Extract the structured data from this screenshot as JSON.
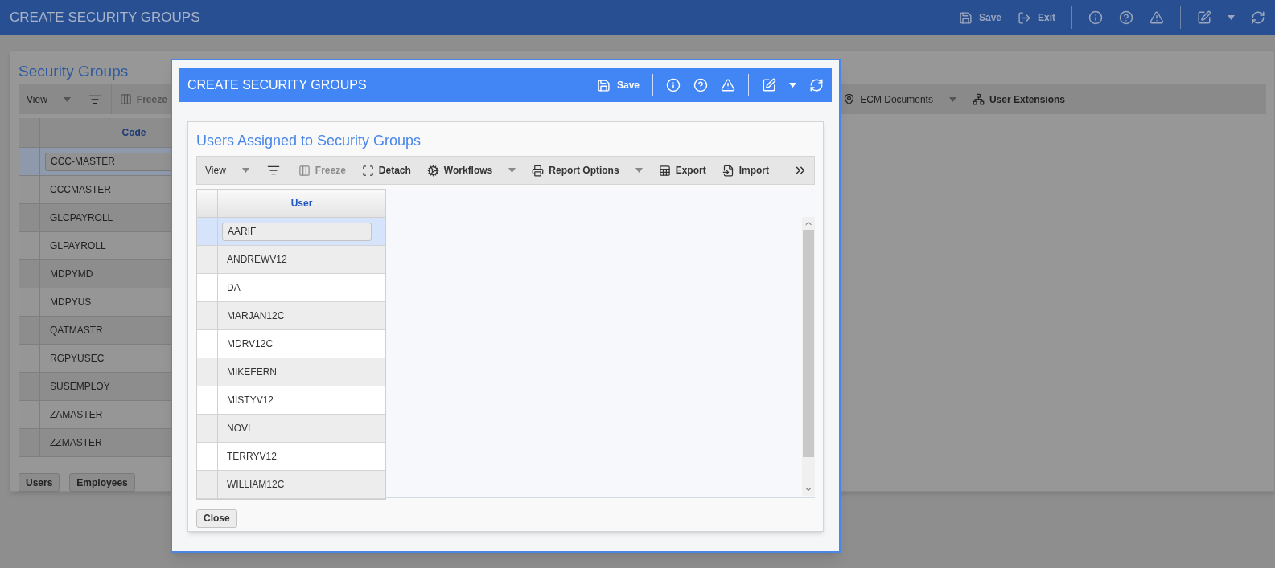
{
  "app_bar": {
    "title": "CREATE SECURITY GROUPS",
    "actions": [
      {
        "label": "Save"
      },
      {
        "label": "Exit"
      }
    ]
  },
  "security_groups": {
    "title": "Security Groups",
    "toolbar_left": [
      {
        "label": "View",
        "kind": "menu",
        "disabled": false
      },
      {
        "kind": "filter"
      },
      {
        "label": "Freeze",
        "kind": "button",
        "disabled": true
      }
    ],
    "toolbar_right": [
      {
        "label": "ECM Documents",
        "kind": "menu",
        "disabled": false
      },
      {
        "label": "User Extensions",
        "kind": "button",
        "disabled": false
      }
    ],
    "table": {
      "columns": [
        "Code"
      ],
      "rows": [
        {
          "code": "CCC-MASTER",
          "selected": true
        },
        {
          "code": "CCCMASTER",
          "selected": false
        },
        {
          "code": "GLCPAYROLL",
          "selected": false
        },
        {
          "code": "GLPAYROLL",
          "selected": false
        },
        {
          "code": "MDPYMD",
          "selected": false
        },
        {
          "code": "MDPYUS",
          "selected": false
        },
        {
          "code": "QATMASTR",
          "selected": false
        },
        {
          "code": "RGPYUSEC",
          "selected": false
        },
        {
          "code": "SUSEMPLOY",
          "selected": false
        },
        {
          "code": "ZAMASTER",
          "selected": false
        },
        {
          "code": "ZZMASTER",
          "selected": false
        }
      ]
    },
    "buttons": [
      "Users",
      "Employees"
    ]
  },
  "dialog": {
    "title": "CREATE SECURITY GROUPS",
    "actions": [
      {
        "label": "Save"
      }
    ],
    "panel_title": "Users Assigned to Security Groups",
    "toolbar": [
      {
        "label": "View",
        "kind": "menu",
        "disabled": false
      },
      {
        "kind": "filter"
      },
      {
        "label": "Freeze",
        "kind": "button",
        "disabled": true
      },
      {
        "label": "Detach",
        "kind": "button",
        "disabled": false
      },
      {
        "label": "Workflows",
        "kind": "menu",
        "disabled": false
      },
      {
        "label": "Report Options",
        "kind": "menu",
        "disabled": false
      },
      {
        "label": "Export",
        "kind": "button",
        "disabled": false
      },
      {
        "label": "Import",
        "kind": "button",
        "disabled": false
      },
      {
        "kind": "more"
      }
    ],
    "table": {
      "columns": [
        "User"
      ],
      "rows": [
        {
          "user": "AARIF",
          "selected": true
        },
        {
          "user": "ANDREWV12",
          "selected": false
        },
        {
          "user": "DA",
          "selected": false
        },
        {
          "user": "MARJAN12C",
          "selected": false
        },
        {
          "user": "MDRV12C",
          "selected": false
        },
        {
          "user": "MIKEFERN",
          "selected": false
        },
        {
          "user": "MISTYV12",
          "selected": false
        },
        {
          "user": "NOVI",
          "selected": false
        },
        {
          "user": "TERRYV12",
          "selected": false
        },
        {
          "user": "WILLIAM12C",
          "selected": false
        }
      ]
    },
    "buttons": [
      "Close"
    ]
  }
}
